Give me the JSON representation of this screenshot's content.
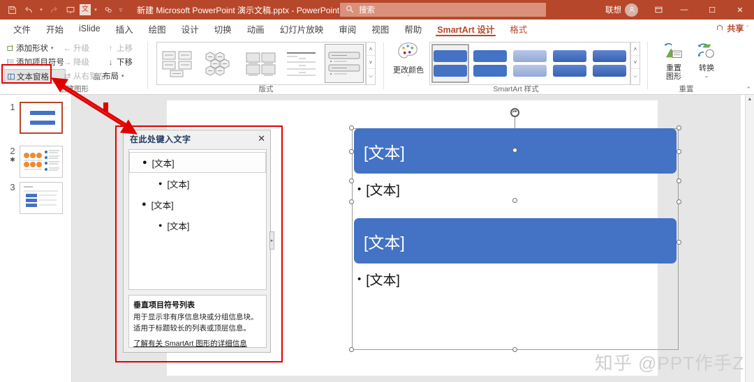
{
  "titlebar": {
    "quick_access": [
      {
        "name": "save-icon",
        "glyph": "⬚"
      },
      {
        "name": "undo-icon",
        "glyph": "↶"
      },
      {
        "name": "redo-icon",
        "glyph": "↻"
      },
      {
        "name": "start-slideshow-icon",
        "glyph": "⬜"
      },
      {
        "name": "translate-icon",
        "glyph": "文"
      },
      {
        "name": "design-ideas-icon",
        "glyph": "⚬"
      },
      {
        "name": "customize-qat-icon",
        "glyph": "▾"
      }
    ],
    "document_title": "新建 Microsoft PowerPoint 演示文稿.pptx",
    "app_name": "PowerPoint",
    "title_separator": "-",
    "search_placeholder": "搜索",
    "account_name": "联想",
    "avatar_glyph": "⛉",
    "ribbon_display_glyph": "⛶",
    "minimize": "—",
    "maximize": "☐",
    "close": "✕"
  },
  "tabs": [
    {
      "label": "文件",
      "state": "normal"
    },
    {
      "label": "开始",
      "state": "normal"
    },
    {
      "label": "iSlide",
      "state": "normal"
    },
    {
      "label": "插入",
      "state": "normal"
    },
    {
      "label": "绘图",
      "state": "normal"
    },
    {
      "label": "设计",
      "state": "normal"
    },
    {
      "label": "切换",
      "state": "normal"
    },
    {
      "label": "动画",
      "state": "normal"
    },
    {
      "label": "幻灯片放映",
      "state": "normal"
    },
    {
      "label": "审阅",
      "state": "normal"
    },
    {
      "label": "视图",
      "state": "normal"
    },
    {
      "label": "帮助",
      "state": "normal"
    },
    {
      "label": "SmartArt 设计",
      "state": "active"
    },
    {
      "label": "格式",
      "state": "accent"
    }
  ],
  "share_button": {
    "label": "共享",
    "icon": "share-icon",
    "caret": "ˇ"
  },
  "ribbon": {
    "groups": [
      {
        "name": "create-graphic",
        "label": "创建图形"
      },
      {
        "name": "layouts",
        "label": "版式"
      },
      {
        "name": "smartart-styles",
        "label": "SmartArt 样式"
      },
      {
        "name": "reset",
        "label": "重置"
      }
    ],
    "create_graphic": {
      "commands": [
        {
          "label": "添加形状",
          "icon": "add-shape-icon",
          "glyph": "❐",
          "disabled": false,
          "caret": true,
          "highlight": false
        },
        {
          "label": "添加项目符号",
          "icon": "add-bullet-icon",
          "glyph": "≡",
          "disabled": false,
          "caret": false,
          "highlight": false
        },
        {
          "label": "文本窗格",
          "icon": "text-pane-icon",
          "glyph": "▥",
          "disabled": false,
          "caret": false,
          "highlight": true
        },
        {
          "label": "升级",
          "icon": "promote-icon",
          "glyph": "←",
          "disabled": true,
          "caret": false,
          "highlight": false
        },
        {
          "label": "降级",
          "icon": "demote-icon",
          "glyph": "→",
          "disabled": true,
          "caret": false,
          "highlight": false
        },
        {
          "label": "从右到左",
          "icon": "rtl-icon",
          "glyph": "⇄",
          "disabled": true,
          "caret": false,
          "highlight": false
        },
        {
          "label": "上移",
          "icon": "move-up-icon",
          "glyph": "↑",
          "disabled": true,
          "caret": false,
          "highlight": false
        },
        {
          "label": "下移",
          "icon": "move-down-icon",
          "glyph": "↓",
          "disabled": false,
          "caret": false,
          "highlight": false
        },
        {
          "label": "布局",
          "icon": "layout-icon",
          "glyph": "品",
          "disabled": false,
          "caret": true,
          "highlight": false
        }
      ]
    },
    "layout_gallery": {
      "items": [
        "layout-hierarchy",
        "layout-hexagon-cluster",
        "layout-grid-matrix",
        "layout-lined-list",
        "layout-vertical-bullet-list"
      ],
      "selected_index": 4,
      "scroll_up": "˄",
      "scroll_down": "˅",
      "more": "⌵"
    },
    "change_colors": {
      "label": "更改颜色",
      "icon": "palette-icon",
      "caret": "ˇ"
    },
    "smartart_styles": {
      "items": [
        {
          "name": "style-simple-fill",
          "top": "#4472C4",
          "bottom": "#4472C4",
          "selected": true
        },
        {
          "name": "style-flat",
          "top": "#4472C4",
          "bottom": "#4472C4",
          "selected": false
        },
        {
          "name": "style-subtle",
          "top": "#9BB0DC",
          "bottom": "#9BB0DC",
          "selected": false
        },
        {
          "name": "style-moderate",
          "top": "#4472C4",
          "bottom": "#4472C4",
          "selected": false
        },
        {
          "name": "style-intense",
          "top": "#4472C4",
          "bottom": "#4472C4",
          "selected": false
        }
      ],
      "scroll_up": "˄",
      "scroll_down": "˅",
      "more": "⌵"
    },
    "reset_group": {
      "buttons": [
        {
          "label_line1": "重置",
          "label_line2": "图形",
          "icon": "reset-graphic-icon",
          "caret": false
        },
        {
          "label_line1": "转换",
          "label_line2": "",
          "icon": "convert-icon",
          "caret": true
        }
      ]
    },
    "collapse_ribbon": "˄"
  },
  "thumbnails": [
    {
      "number": "1",
      "selected": true,
      "marker": "",
      "kind": "two-blue-bars"
    },
    {
      "number": "2",
      "selected": false,
      "marker": "✱",
      "kind": "orange-circles-list"
    },
    {
      "number": "3",
      "selected": false,
      "marker": "",
      "kind": "blue-table"
    }
  ],
  "slide": {
    "smartart": {
      "type": "vertical-bullet-list",
      "blocks": [
        {
          "kind": "header",
          "text": "[文本]",
          "fill": "#4472C4"
        },
        {
          "kind": "bullet",
          "text": "[文本]",
          "bullet": "•"
        },
        {
          "kind": "header",
          "text": "[文本]",
          "fill": "#4472C4"
        },
        {
          "kind": "bullet",
          "text": "[文本]",
          "bullet": "•"
        }
      ]
    }
  },
  "text_pane": {
    "title": "在此处键入文字",
    "close_glyph": "✕",
    "items": [
      {
        "text": "[文本]",
        "level": 1,
        "bullet": "●",
        "active": true
      },
      {
        "text": "[文本]",
        "level": 2,
        "bullet": "●",
        "active": false
      },
      {
        "text": "[文本]",
        "level": 1,
        "bullet": "●",
        "active": false
      },
      {
        "text": "[文本]",
        "level": 2,
        "bullet": "●",
        "active": false
      }
    ],
    "description_title": "垂直项目符号列表",
    "description_body": "用于显示非有序信息块或分组信息块。适用于标题较长的列表或顶层信息。",
    "description_link": "了解有关 SmartArt 图形的详细信息",
    "grip_glyph": "▸"
  },
  "annotations": {
    "color": "#E00000",
    "boxes": [
      "text-pane-button-highlight",
      "text-pane-dialog-highlight"
    ],
    "arrow": "double-headed-arrow"
  },
  "watermark": "知乎 @PPT作手Z",
  "colors": {
    "title_bar": "#B7472A",
    "accent_blue": "#4472C4",
    "annotation_red": "#E00000",
    "workspace_gray": "#E6E6E6"
  }
}
